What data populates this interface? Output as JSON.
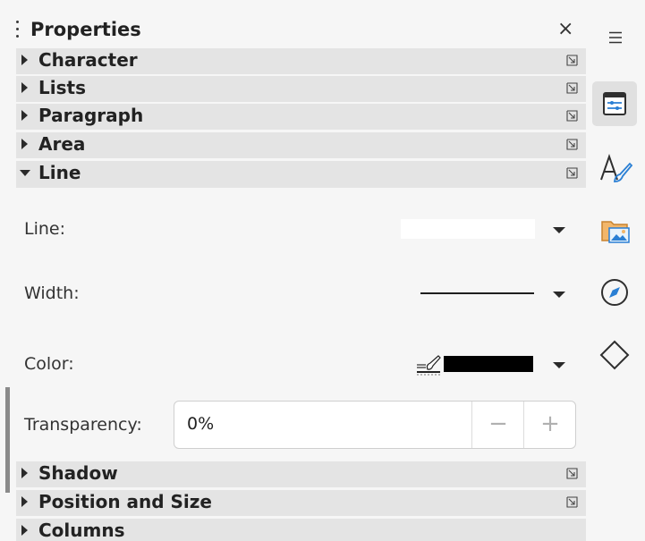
{
  "panel": {
    "title": "Properties",
    "close_label": "×",
    "sections_top": [
      {
        "label": "Character",
        "expanded": false
      },
      {
        "label": "Lists",
        "expanded": false
      },
      {
        "label": "Paragraph",
        "expanded": false
      },
      {
        "label": "Area",
        "expanded": false
      },
      {
        "label": "Line",
        "expanded": true
      }
    ],
    "line_section": {
      "line_label": "Line:",
      "width_label": "Width:",
      "color_label": "Color:",
      "color_value": "#000000",
      "transparency_label": "Transparency:",
      "transparency_value": "0%",
      "minus_label": "−",
      "plus_label": "+"
    },
    "sections_bottom": [
      {
        "label": "Shadow",
        "expanded": false
      },
      {
        "label": "Position and Size",
        "expanded": false
      },
      {
        "label": "Columns",
        "expanded": false
      }
    ]
  },
  "sidebar_rail": {
    "menu_icon": "hamburger-menu-icon",
    "buttons": [
      {
        "icon": "properties-icon",
        "active": true
      },
      {
        "icon": "styles-icon",
        "active": false
      },
      {
        "icon": "gallery-icon",
        "active": false
      },
      {
        "icon": "navigator-icon",
        "active": false
      },
      {
        "icon": "shapes-icon",
        "active": false
      }
    ]
  },
  "colors": {
    "panel_bg": "#f6f6f6",
    "section_header_bg": "#e4e4e4",
    "line_color": "#000000"
  }
}
